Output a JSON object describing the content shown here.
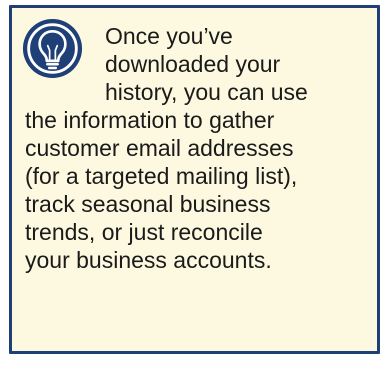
{
  "tip": {
    "icon": "lightbulb-icon",
    "colors": {
      "border": "#1f3f77",
      "background": "#fdf9e0",
      "icon_circle": "#1f3f77",
      "text": "#1a1a1a"
    },
    "lines": [
      "Once you’ve",
      "downloaded your",
      "history, you can use",
      "the information to gather",
      "customer email addresses",
      "(for a targeted mailing list),",
      "track seasonal business",
      "trends, or just reconcile",
      "your business accounts."
    ]
  }
}
